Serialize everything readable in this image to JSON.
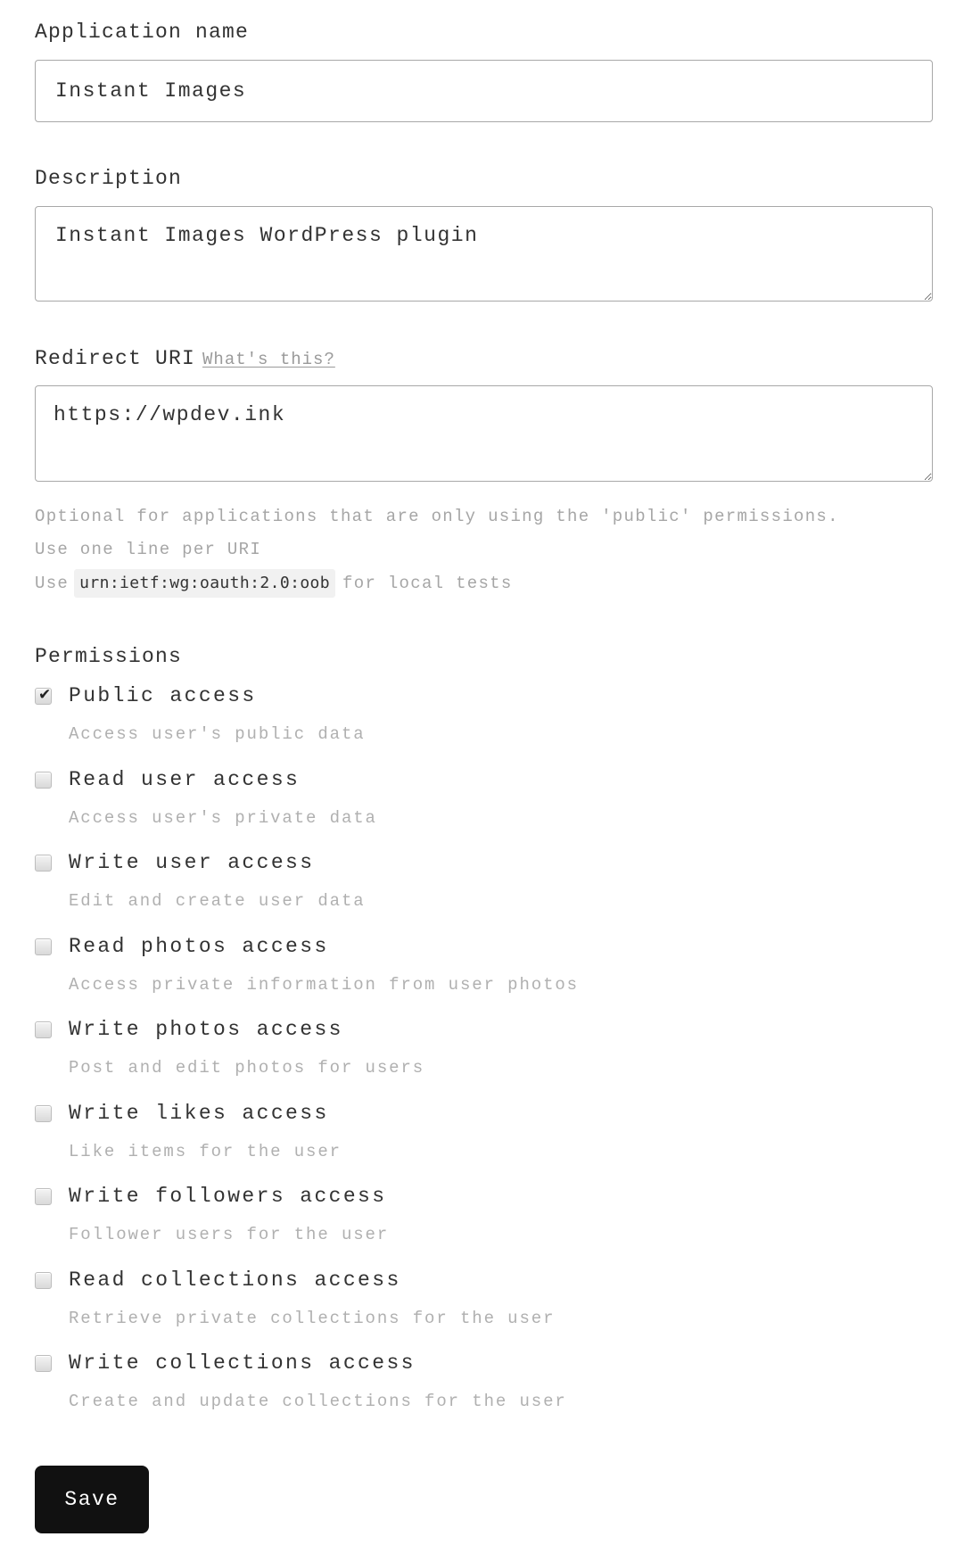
{
  "form": {
    "app_name": {
      "label": "Application name",
      "value": "Instant Images"
    },
    "description": {
      "label": "Description",
      "value": "Instant Images WordPress plugin"
    },
    "redirect_uri": {
      "label": "Redirect URI",
      "help_link": "What's this?",
      "value": "https://wpdev.ink",
      "help_lines": {
        "line1": "Optional for applications that are only using the 'public' permissions.",
        "line2": "Use one line per URI",
        "line3_prefix": "Use",
        "line3_code": "urn:ietf:wg:oauth:2.0:oob",
        "line3_suffix": "for local tests"
      }
    },
    "permissions": {
      "heading": "Permissions",
      "items": [
        {
          "label": "Public access",
          "description": "Access user's public data",
          "checked": true
        },
        {
          "label": "Read user access",
          "description": "Access user's private data",
          "checked": false
        },
        {
          "label": "Write user access",
          "description": "Edit and create user data",
          "checked": false
        },
        {
          "label": "Read photos access",
          "description": "Access private information from user photos",
          "checked": false
        },
        {
          "label": "Write photos access",
          "description": "Post and edit photos for users",
          "checked": false
        },
        {
          "label": "Write likes access",
          "description": "Like items for the user",
          "checked": false
        },
        {
          "label": "Write followers access",
          "description": "Follower users for the user",
          "checked": false
        },
        {
          "label": "Read collections access",
          "description": "Retrieve private collections for the user",
          "checked": false
        },
        {
          "label": "Write collections access",
          "description": "Create and update collections for the user",
          "checked": false
        }
      ]
    },
    "save_label": "Save"
  },
  "colors": {
    "text": "#333333",
    "muted": "#b0b0b0",
    "button_bg": "#111111",
    "button_text": "#ffffff",
    "border": "#a8a8a8",
    "code_bg": "#f1f1f1"
  }
}
